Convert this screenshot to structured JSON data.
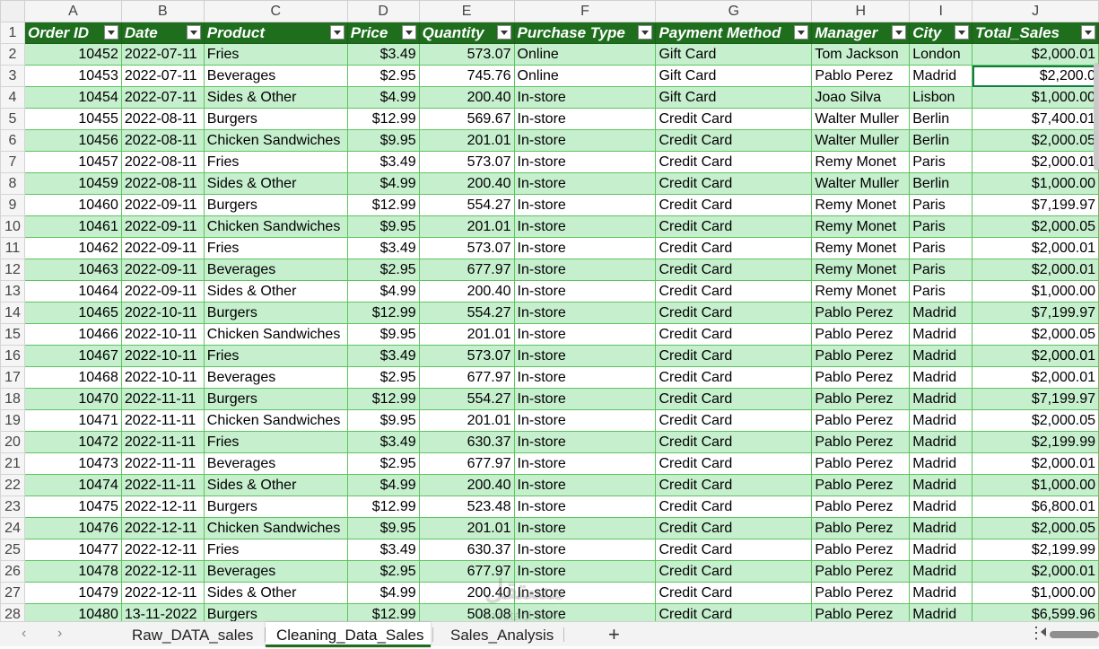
{
  "columns": [
    "A",
    "B",
    "C",
    "D",
    "E",
    "F",
    "G",
    "H",
    "I",
    "J"
  ],
  "headers": [
    "Order ID",
    "Date",
    "Product",
    "Price",
    "Quantity",
    "Purchase Type",
    "Payment Method",
    "Manager",
    "City",
    "Total_Sales"
  ],
  "rows": [
    [
      "10452",
      "2022-07-11",
      "Fries",
      "$3.49",
      "573.07",
      "Online",
      "Gift Card",
      "Tom Jackson",
      "London",
      "$2,000.01"
    ],
    [
      "10453",
      "2022-07-11",
      "Beverages",
      "$2.95",
      "745.76",
      "Online",
      "Gift Card",
      "Pablo Perez",
      "Madrid",
      "$2,200.0"
    ],
    [
      "10454",
      "2022-07-11",
      "Sides & Other",
      "$4.99",
      "200.40",
      "In-store",
      "Gift Card",
      "Joao Silva",
      "Lisbon",
      "$1,000.00"
    ],
    [
      "10455",
      "2022-08-11",
      "Burgers",
      "$12.99",
      "569.67",
      "In-store",
      "Credit Card",
      "Walter Muller",
      "Berlin",
      "$7,400.01"
    ],
    [
      "10456",
      "2022-08-11",
      "Chicken Sandwiches",
      "$9.95",
      "201.01",
      "In-store",
      "Credit Card",
      "Walter Muller",
      "Berlin",
      "$2,000.05"
    ],
    [
      "10457",
      "2022-08-11",
      "Fries",
      "$3.49",
      "573.07",
      "In-store",
      "Credit Card",
      "Remy Monet",
      "Paris",
      "$2,000.01"
    ],
    [
      "10459",
      "2022-08-11",
      "Sides & Other",
      "$4.99",
      "200.40",
      "In-store",
      "Credit Card",
      "Walter Muller",
      "Berlin",
      "$1,000.00"
    ],
    [
      "10460",
      "2022-09-11",
      "Burgers",
      "$12.99",
      "554.27",
      "In-store",
      "Credit Card",
      "Remy Monet",
      "Paris",
      "$7,199.97"
    ],
    [
      "10461",
      "2022-09-11",
      "Chicken Sandwiches",
      "$9.95",
      "201.01",
      "In-store",
      "Credit Card",
      "Remy Monet",
      "Paris",
      "$2,000.05"
    ],
    [
      "10462",
      "2022-09-11",
      "Fries",
      "$3.49",
      "573.07",
      "In-store",
      "Credit Card",
      "Remy Monet",
      "Paris",
      "$2,000.01"
    ],
    [
      "10463",
      "2022-09-11",
      "Beverages",
      "$2.95",
      "677.97",
      "In-store",
      "Credit Card",
      "Remy Monet",
      "Paris",
      "$2,000.01"
    ],
    [
      "10464",
      "2022-09-11",
      "Sides & Other",
      "$4.99",
      "200.40",
      "In-store",
      "Credit Card",
      "Remy Monet",
      "Paris",
      "$1,000.00"
    ],
    [
      "10465",
      "2022-10-11",
      "Burgers",
      "$12.99",
      "554.27",
      "In-store",
      "Credit Card",
      "Pablo Perez",
      "Madrid",
      "$7,199.97"
    ],
    [
      "10466",
      "2022-10-11",
      "Chicken Sandwiches",
      "$9.95",
      "201.01",
      "In-store",
      "Credit Card",
      "Pablo Perez",
      "Madrid",
      "$2,000.05"
    ],
    [
      "10467",
      "2022-10-11",
      "Fries",
      "$3.49",
      "573.07",
      "In-store",
      "Credit Card",
      "Pablo Perez",
      "Madrid",
      "$2,000.01"
    ],
    [
      "10468",
      "2022-10-11",
      "Beverages",
      "$2.95",
      "677.97",
      "In-store",
      "Credit Card",
      "Pablo Perez",
      "Madrid",
      "$2,000.01"
    ],
    [
      "10470",
      "2022-11-11",
      "Burgers",
      "$12.99",
      "554.27",
      "In-store",
      "Credit Card",
      "Pablo Perez",
      "Madrid",
      "$7,199.97"
    ],
    [
      "10471",
      "2022-11-11",
      "Chicken Sandwiches",
      "$9.95",
      "201.01",
      "In-store",
      "Credit Card",
      "Pablo Perez",
      "Madrid",
      "$2,000.05"
    ],
    [
      "10472",
      "2022-11-11",
      "Fries",
      "$3.49",
      "630.37",
      "In-store",
      "Credit Card",
      "Pablo Perez",
      "Madrid",
      "$2,199.99"
    ],
    [
      "10473",
      "2022-11-11",
      "Beverages",
      "$2.95",
      "677.97",
      "In-store",
      "Credit Card",
      "Pablo Perez",
      "Madrid",
      "$2,000.01"
    ],
    [
      "10474",
      "2022-11-11",
      "Sides & Other",
      "$4.99",
      "200.40",
      "In-store",
      "Credit Card",
      "Pablo Perez",
      "Madrid",
      "$1,000.00"
    ],
    [
      "10475",
      "2022-12-11",
      "Burgers",
      "$12.99",
      "523.48",
      "In-store",
      "Credit Card",
      "Pablo Perez",
      "Madrid",
      "$6,800.01"
    ],
    [
      "10476",
      "2022-12-11",
      "Chicken Sandwiches",
      "$9.95",
      "201.01",
      "In-store",
      "Credit Card",
      "Pablo Perez",
      "Madrid",
      "$2,000.05"
    ],
    [
      "10477",
      "2022-12-11",
      "Fries",
      "$3.49",
      "630.37",
      "In-store",
      "Credit Card",
      "Pablo Perez",
      "Madrid",
      "$2,199.99"
    ],
    [
      "10478",
      "2022-12-11",
      "Beverages",
      "$2.95",
      "677.97",
      "In-store",
      "Credit Card",
      "Pablo Perez",
      "Madrid",
      "$2,000.01"
    ],
    [
      "10479",
      "2022-12-11",
      "Sides & Other",
      "$4.99",
      "200.40",
      "In-store",
      "Credit Card",
      "Pablo Perez",
      "Madrid",
      "$1,000.00"
    ],
    [
      "10480",
      "13-11-2022",
      "Burgers",
      "$12.99",
      "508.08",
      "In-store",
      "Credit Card",
      "Pablo Perez",
      "Madrid",
      "$6,599.96"
    ]
  ],
  "selected_cell": "J3",
  "tabs": [
    {
      "label": "Raw_DATA_sales",
      "active": false
    },
    {
      "label": "Cleaning_Data_Sales",
      "active": true
    },
    {
      "label": "Sales_Analysis",
      "active": false
    }
  ],
  "watermark": {
    "text": "مستقل",
    "sub": "mostaql.com"
  },
  "colors": {
    "header_bg": "#1e6e1e",
    "band_bg": "#c6efce",
    "border": "#5ec45e",
    "accent": "#107c41"
  },
  "icons": {
    "prev": "chevron-left-icon",
    "next": "chevron-right-icon",
    "add": "plus-icon",
    "more": "more-vertical-icon"
  }
}
